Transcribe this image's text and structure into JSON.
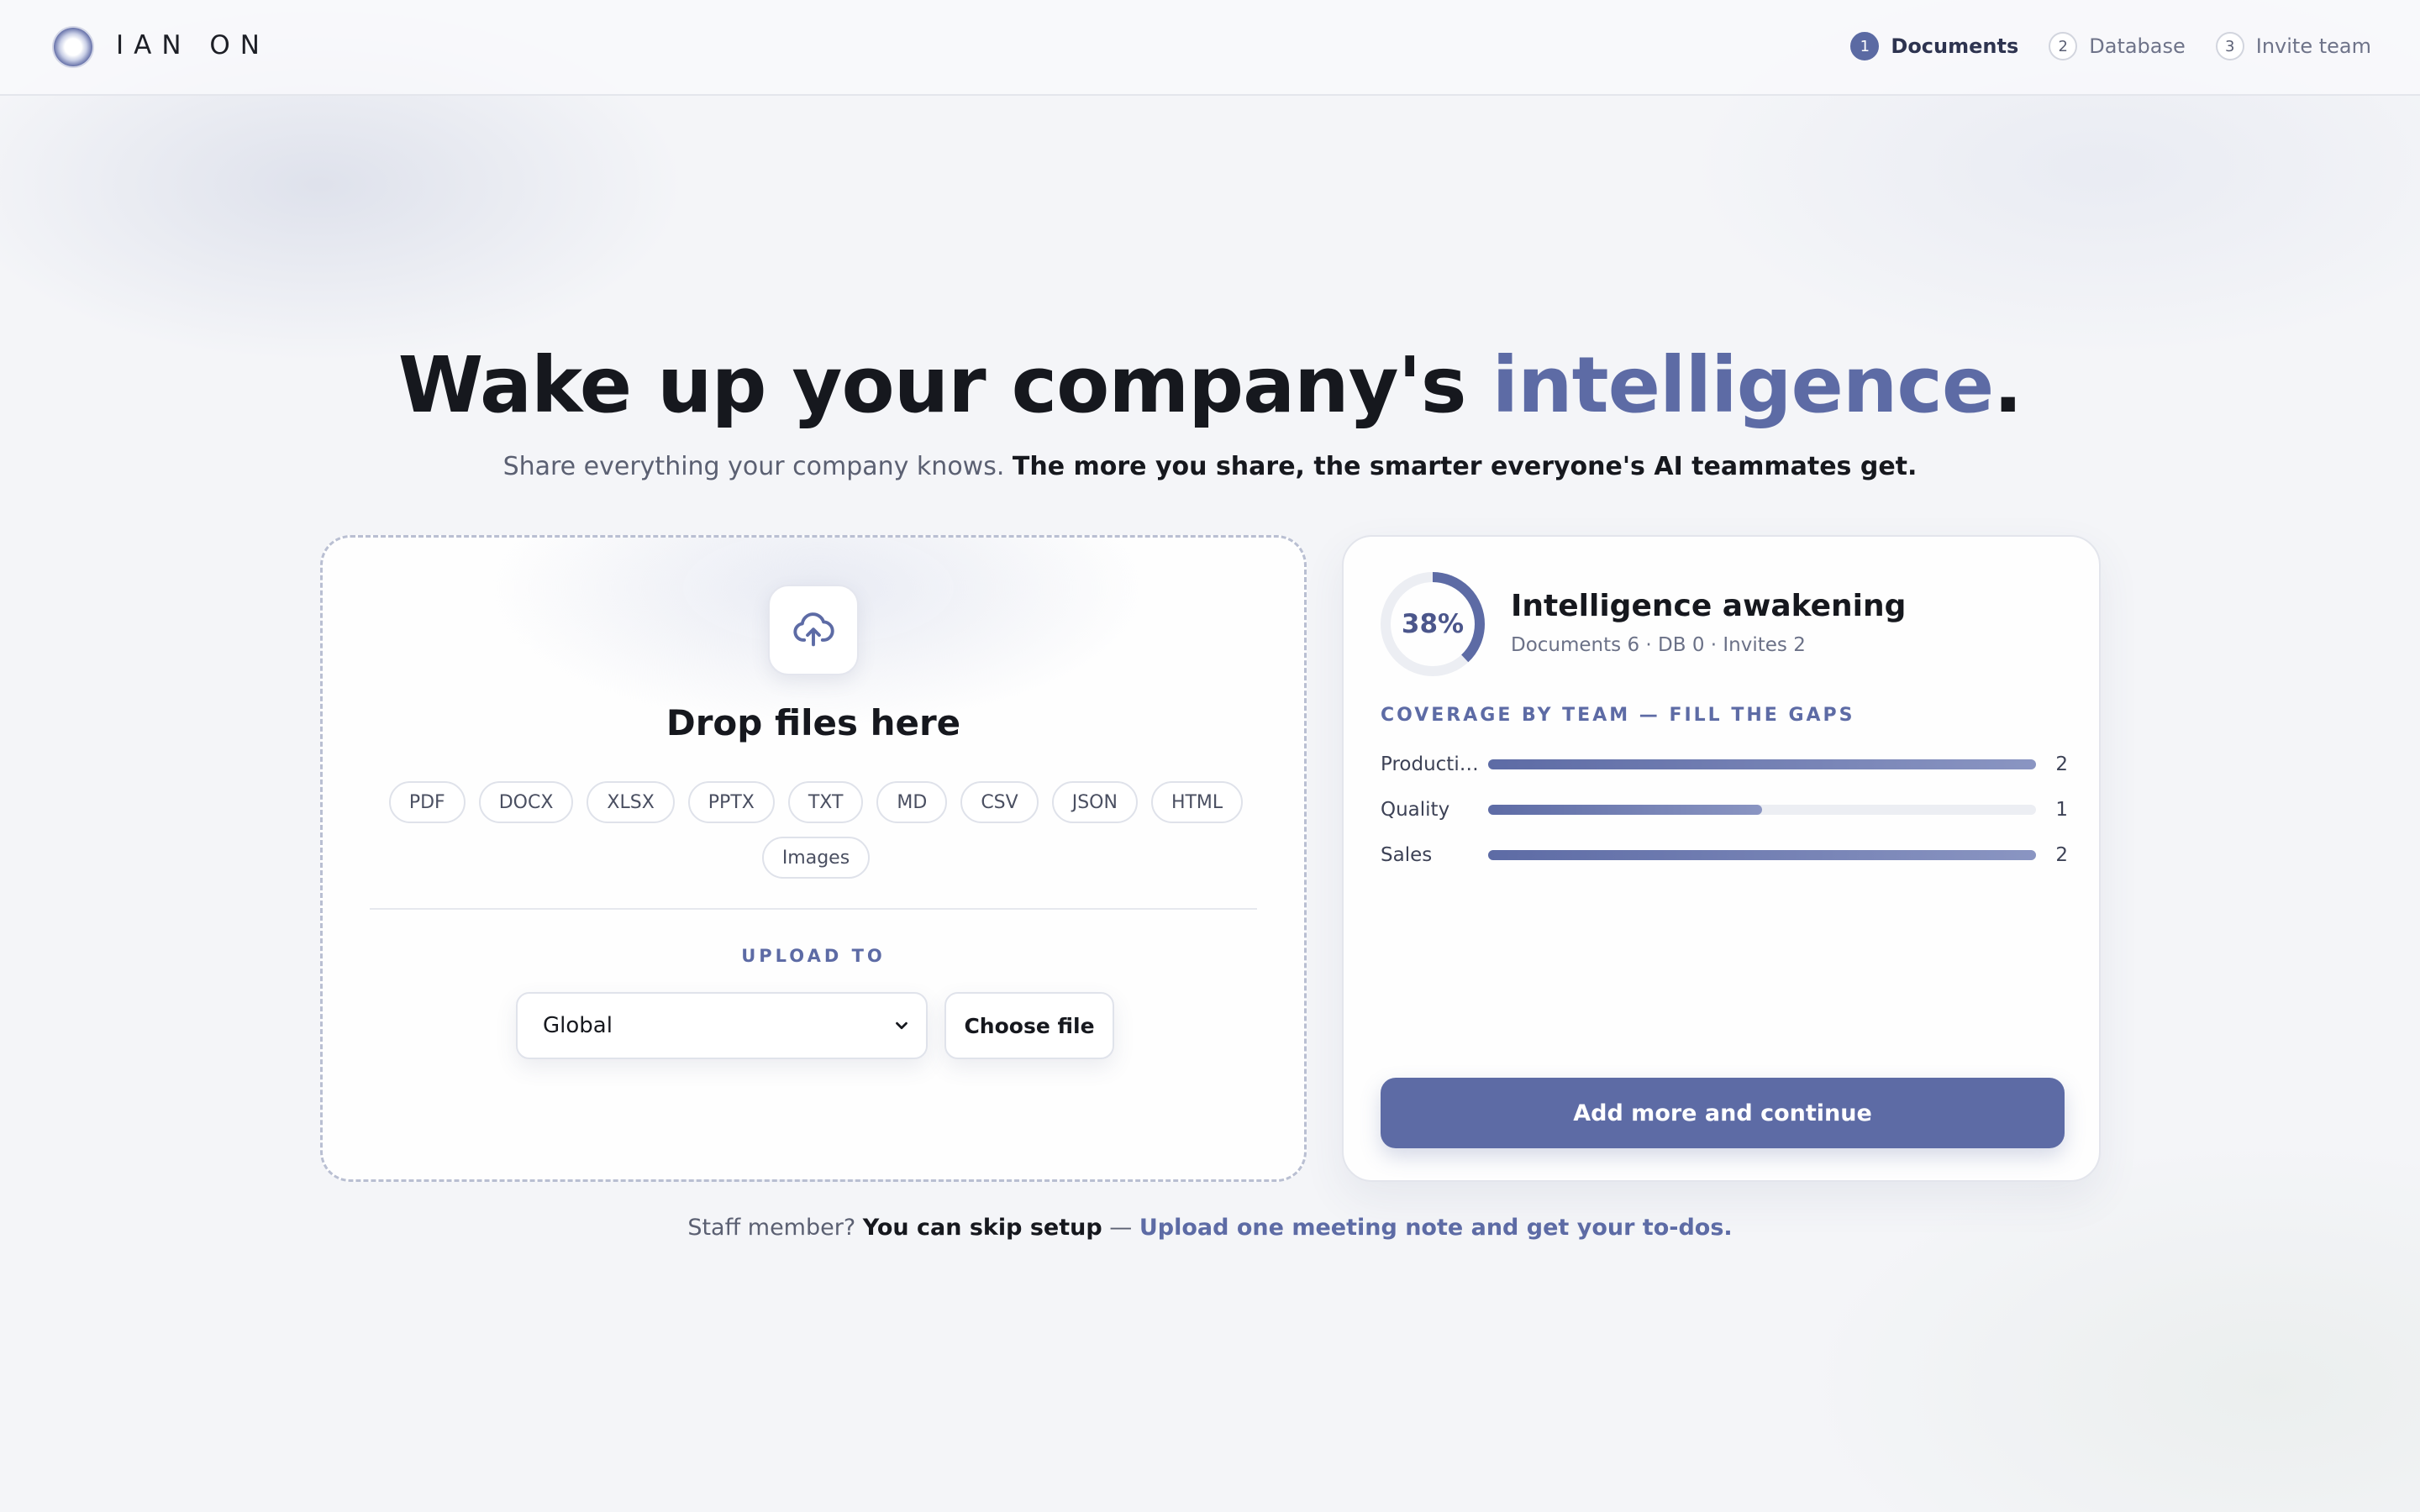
{
  "brand": {
    "name": "IAN ON"
  },
  "steps": [
    {
      "num": "1",
      "label": "Documents",
      "active": true
    },
    {
      "num": "2",
      "label": "Database",
      "active": false
    },
    {
      "num": "3",
      "label": "Invite team",
      "active": false
    }
  ],
  "hero": {
    "title_main": "Wake up your company's ",
    "title_accent": "intelligence",
    "title_end": ".",
    "subtitle_plain": "Share everything your company knows. ",
    "subtitle_strong": "The more you share, the smarter everyone's AI teammates get."
  },
  "upload": {
    "icon": "cloud-upload-icon",
    "title": "Drop files here",
    "file_types": [
      "PDF",
      "DOCX",
      "XLSX",
      "PPTX",
      "TXT",
      "MD",
      "CSV",
      "JSON",
      "HTML",
      "Images"
    ],
    "upload_to_label": "UPLOAD TO",
    "destination_value": "Global",
    "choose_file_label": "Choose file"
  },
  "progress": {
    "percent": 38,
    "percent_label": "38%",
    "title": "Intelligence awakening",
    "stats": "Documents 6 · DB 0 · Invites 2",
    "coverage_label": "COVERAGE BY TEAM — FILL THE GAPS",
    "teams": [
      {
        "name": "Producti…",
        "count": "2",
        "fill": 1.0
      },
      {
        "name": "Quality",
        "count": "1",
        "fill": 0.5
      },
      {
        "name": "Sales",
        "count": "2",
        "fill": 1.0
      }
    ],
    "continue_label": "Add more and continue"
  },
  "footer": {
    "plain": "Staff member? ",
    "strong": "You can skip setup",
    "sep": " — ",
    "link": "Upload one meeting note and get your to-dos."
  },
  "colors": {
    "accent": "#5d6ba5",
    "text_primary": "#16181e",
    "text_muted": "#5b6072",
    "background": "#f4f5f8"
  }
}
